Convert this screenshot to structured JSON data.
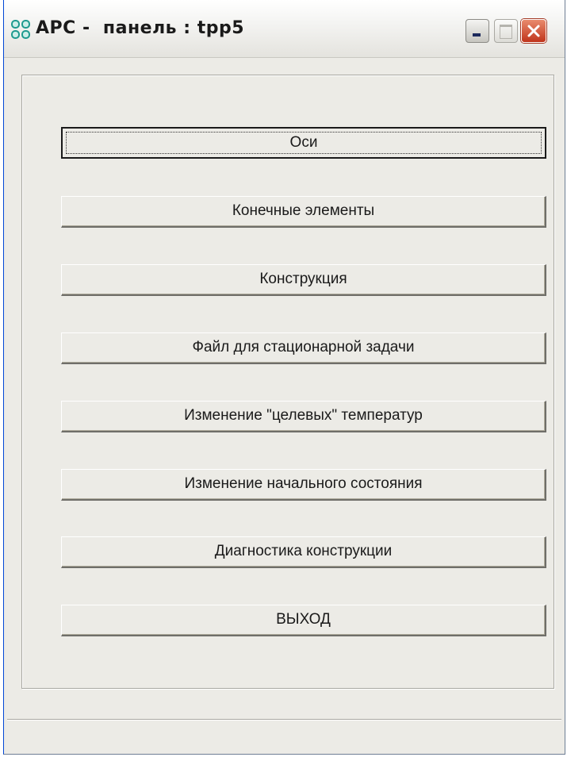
{
  "window": {
    "title": "АРС -  панель : tpp5",
    "app_icon": "clover-grid-icon",
    "controls": {
      "minimize_icon": "minimize-icon",
      "maximize_icon": "maximize-icon",
      "close_icon": "close-icon"
    }
  },
  "panel": {
    "buttons": [
      {
        "label": "Оси",
        "focused": true
      },
      {
        "label": "Конечные элементы"
      },
      {
        "label": "Конструкция"
      },
      {
        "label": "Файл для стационарной задачи"
      },
      {
        "label": "Изменение \"целевых\" температур"
      },
      {
        "label": "Изменение начального состояния"
      },
      {
        "label": "Диагностика конструкции"
      },
      {
        "label": "ВЫХОД"
      }
    ]
  },
  "statusbar": {
    "text": ""
  },
  "colors": {
    "face": "#ecebe6",
    "close_red": "#c0341b",
    "icon_teal": "#1e9a8f"
  }
}
